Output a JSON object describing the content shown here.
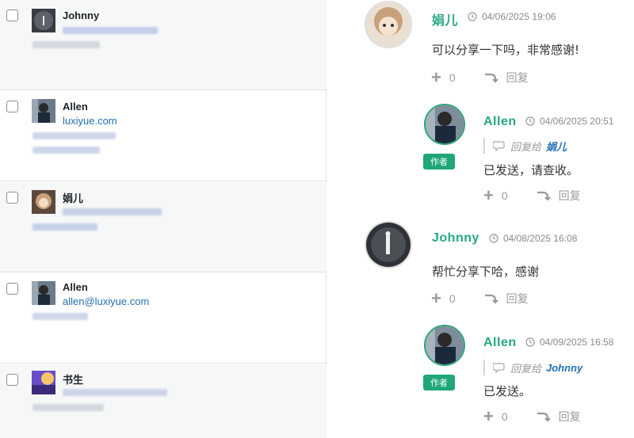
{
  "left_list": {
    "rows": [
      {
        "name": "Johnny",
        "email": ""
      },
      {
        "name": "Allen",
        "email": "luxiyue.com"
      },
      {
        "name": "娟儿",
        "email": ""
      },
      {
        "name": "Allen",
        "email": "allen@luxiyue.com"
      },
      {
        "name": "书生",
        "email": ""
      }
    ]
  },
  "comments": [
    {
      "author": "娟儿",
      "time": "04/06/2025 19:06",
      "text": "可以分享一下吗，非常感谢!",
      "likes": "0",
      "reply_label": "回复"
    },
    {
      "author": "Allen",
      "badge": "作者",
      "time": "04/06/2025 20:51",
      "reply_prefix": "回复给",
      "reply_target": "娟儿",
      "text": "已发送，请查收。",
      "likes": "0",
      "reply_label": "回复"
    },
    {
      "author": "Johnny",
      "time": "04/08/2025 16:08",
      "text": "帮忙分享下哈，感谢",
      "likes": "0",
      "reply_label": "回复"
    },
    {
      "author": "Allen",
      "badge": "作者",
      "time": "04/09/2025 16:58",
      "reply_prefix": "回复给",
      "reply_target": "Johnny",
      "text": "已发送。",
      "likes": "0",
      "reply_label": "回复"
    }
  ],
  "colors": {
    "accent_green": "#26a77f",
    "link_blue": "#2271b1",
    "badge_green": "#1fa67a"
  },
  "icons": [
    "checkbox",
    "avatar",
    "clock-icon",
    "plus-icon",
    "reply-arrow-icon",
    "comment-bubble-icon"
  ]
}
